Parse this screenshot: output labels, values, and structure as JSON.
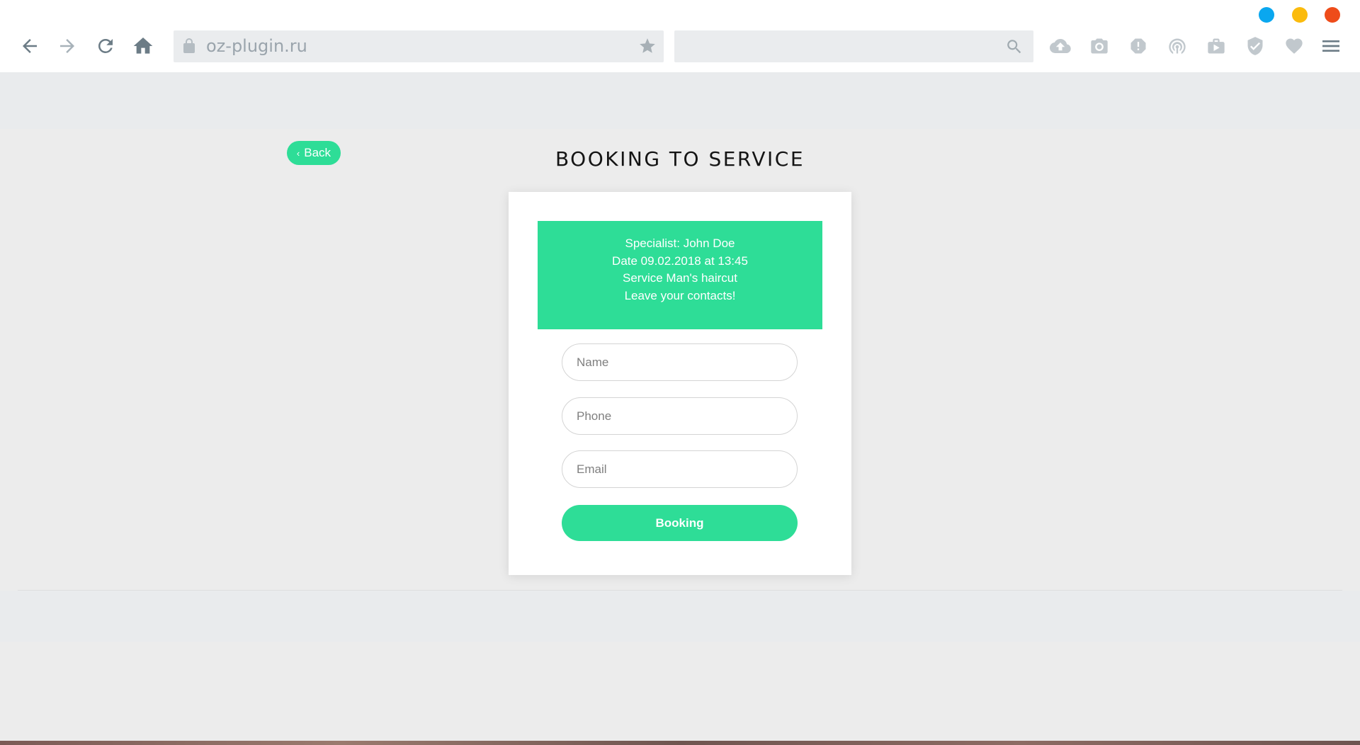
{
  "browser": {
    "url": "oz-plugin.ru",
    "search_placeholder": "",
    "window_controls": [
      {
        "name": "minimize",
        "color": "#0aa7ef"
      },
      {
        "name": "maximize",
        "color": "#fbbb0d"
      },
      {
        "name": "close",
        "color": "#ee4c1a"
      }
    ],
    "nav_icons": [
      "back-arrow-icon",
      "forward-arrow-icon",
      "reload-icon",
      "home-icon"
    ],
    "toolbar_icons": [
      "cloud-upload-icon",
      "camera-icon",
      "alert-icon",
      "broadcast-icon",
      "media-case-icon",
      "shield-check-icon",
      "heart-icon",
      "hamburger-menu-icon"
    ]
  },
  "page": {
    "back_label": "Back",
    "title": "BOOKING TO SERVICE",
    "info": {
      "specialist": "Specialist: John Doe",
      "date": "Date 09.02.2018 at 13:45",
      "service": "Service Man's haircut",
      "prompt": "Leave your contacts!"
    },
    "form": {
      "name_placeholder": "Name",
      "phone_placeholder": "Phone",
      "email_placeholder": "Email",
      "submit_label": "Booking"
    },
    "accent_color": "#2edd97"
  }
}
